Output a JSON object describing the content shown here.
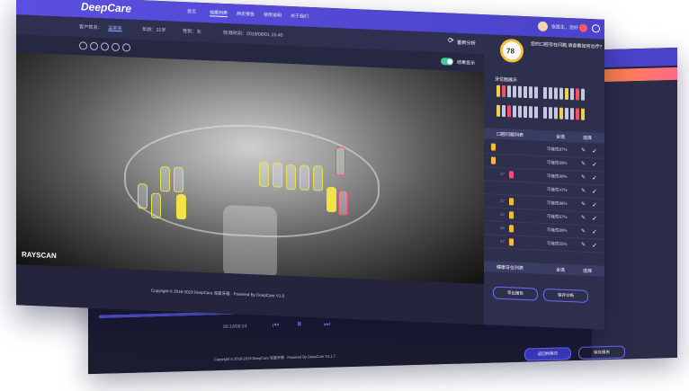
{
  "app": {
    "name": "DeepCare"
  },
  "nav": {
    "items": [
      "首页",
      "档案列表",
      "病史报告",
      "使用说明",
      "关于我们"
    ],
    "active": 1
  },
  "user": {
    "name": "张医生，您好"
  },
  "patient": {
    "name_label": "客户姓名：",
    "name": "温某某",
    "age": "年龄：22岁",
    "gender": "性别：女",
    "time": "检测时间：2019/08/01 15:40"
  },
  "actions": {
    "reanalyze": "重新分析",
    "show_result": "结果显示"
  },
  "score": {
    "value": "78",
    "unit": "分",
    "text": "您的口腔存在问题,请查看如何治疗?"
  },
  "panel": {
    "dental_map": "牙位图展示",
    "problem_list": "口腔问题列表",
    "health_list": "健康牙位列表",
    "select_all": "全选",
    "select": "选择"
  },
  "problems": [
    {
      "pct": "可能性87%"
    },
    {
      "pct": "可能性69%"
    },
    {
      "num": "27",
      "pct": "可能性90%"
    },
    {
      "pct": "可能性47%"
    },
    {
      "num": "37",
      "pct": "可能性96%"
    },
    {
      "num": "42",
      "pct": "可能性67%"
    },
    {
      "num": "46",
      "pct": "可能性89%"
    },
    {
      "num": "47",
      "pct": "可能性55%"
    }
  ],
  "player": {
    "time": "00:10/00:24"
  },
  "buttons": {
    "export": "导出报告",
    "save": "保存诊断",
    "back_list": "返回档案页",
    "save_report": "保存报告"
  },
  "brand": {
    "xray": "RAYSCAN"
  },
  "footer": {
    "copyright": "Copyright © 2016-2019 DeepCare 深蓝牙盾 · Powered By DeepCare V1.0",
    "copyright_back": "Copyright © 2016-2019 DeepCare 深蓝牙盾 · Powered By DeepCare V1.1.7"
  }
}
